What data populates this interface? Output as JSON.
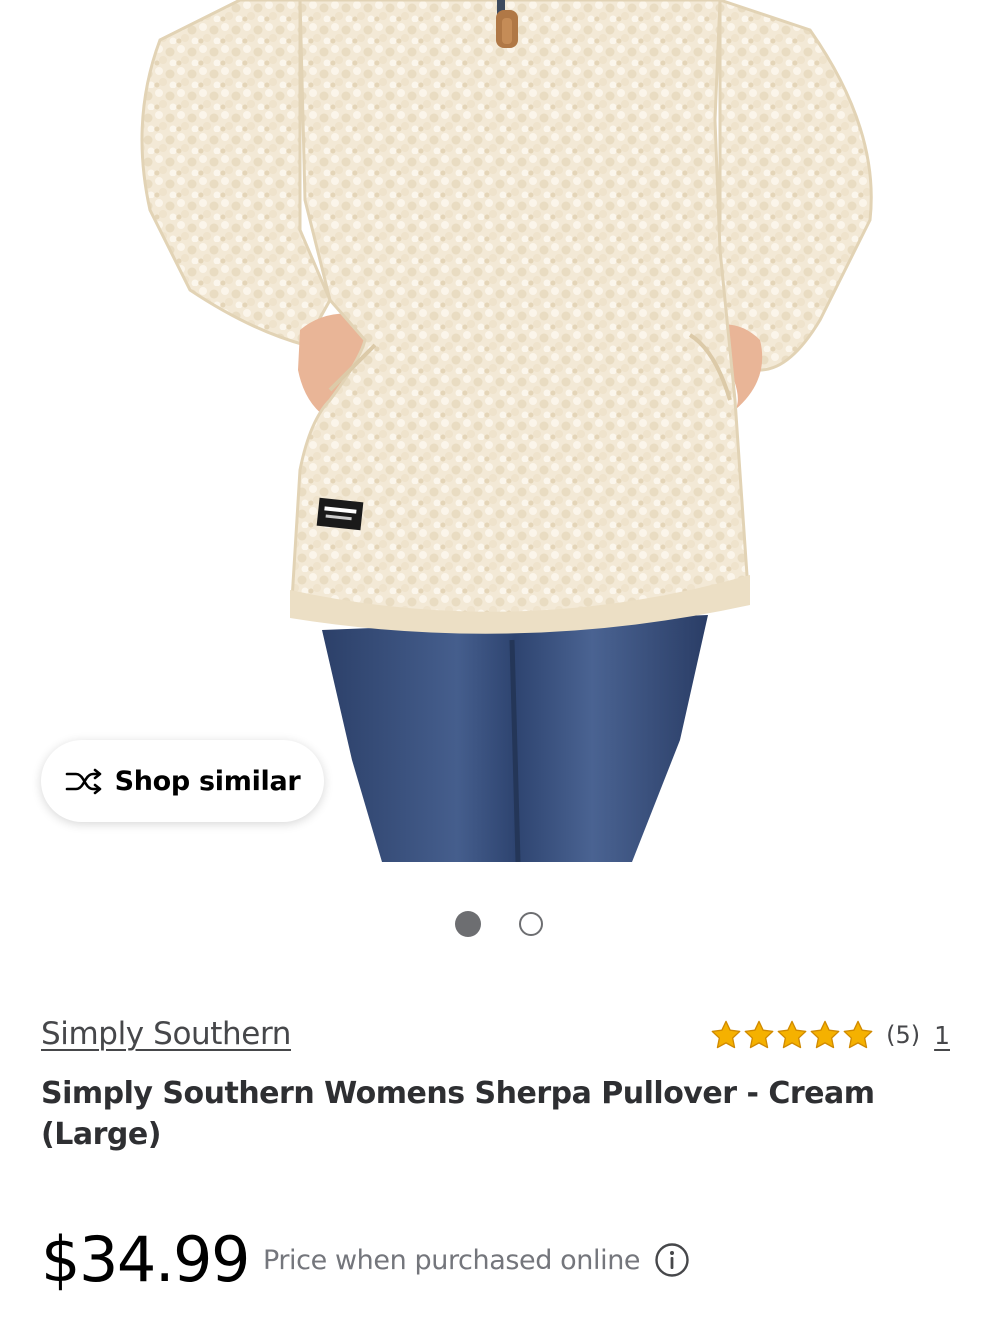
{
  "product": {
    "brand": "Simply Southern",
    "title": "Simply Southern Womens Sherpa Pullover - Cream (Large)",
    "price": "$34.99",
    "price_note": "Price when purchased online",
    "rating": {
      "stars": 5,
      "max_stars": 5,
      "review_count": "(5)",
      "qa_count": "1"
    }
  },
  "image": {
    "shop_similar_label": "Shop similar",
    "carousel": {
      "total": 2,
      "active_index": 0
    }
  },
  "colors": {
    "star": "#f5b100",
    "dot": "#6d6e71",
    "text": "#2e2f32",
    "muted": "#74767c"
  }
}
